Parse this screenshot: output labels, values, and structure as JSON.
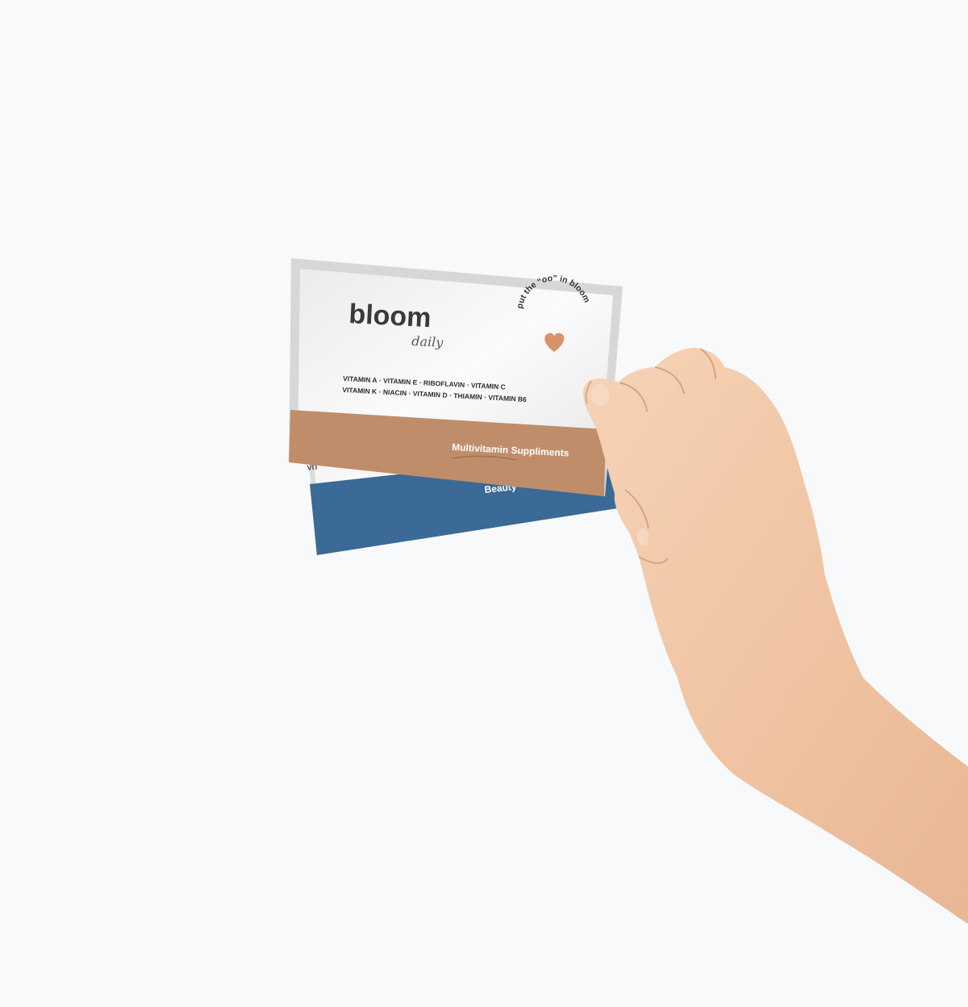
{
  "scene": {
    "background": "#f8f9fa"
  },
  "front_sachet": {
    "brand": "bloom",
    "sub_brand": "daily",
    "vitamins_line1": [
      "VITAMIN A",
      "VITAMIN E",
      "RIBOFLAVIN",
      "VITAMIN C"
    ],
    "vitamins_line2": [
      "VITAMIN K",
      "NIACIN",
      "VITAMIN D",
      "THIAMIN",
      "VITAMIN B6"
    ],
    "band_label": "Multivitamin Suppliments",
    "band_color": "#c08d6a",
    "accent_color": "#d89369",
    "stamp_text": "put the “oo” in bloom",
    "stamp_icon": "heart-icon"
  },
  "back_sachet": {
    "band_label_partial": "Beauty",
    "band_color": "#3a6a95",
    "partial_text": "VIT"
  },
  "hand": {
    "icon": "hand-icon",
    "skin_color": "#f2c9a8"
  }
}
